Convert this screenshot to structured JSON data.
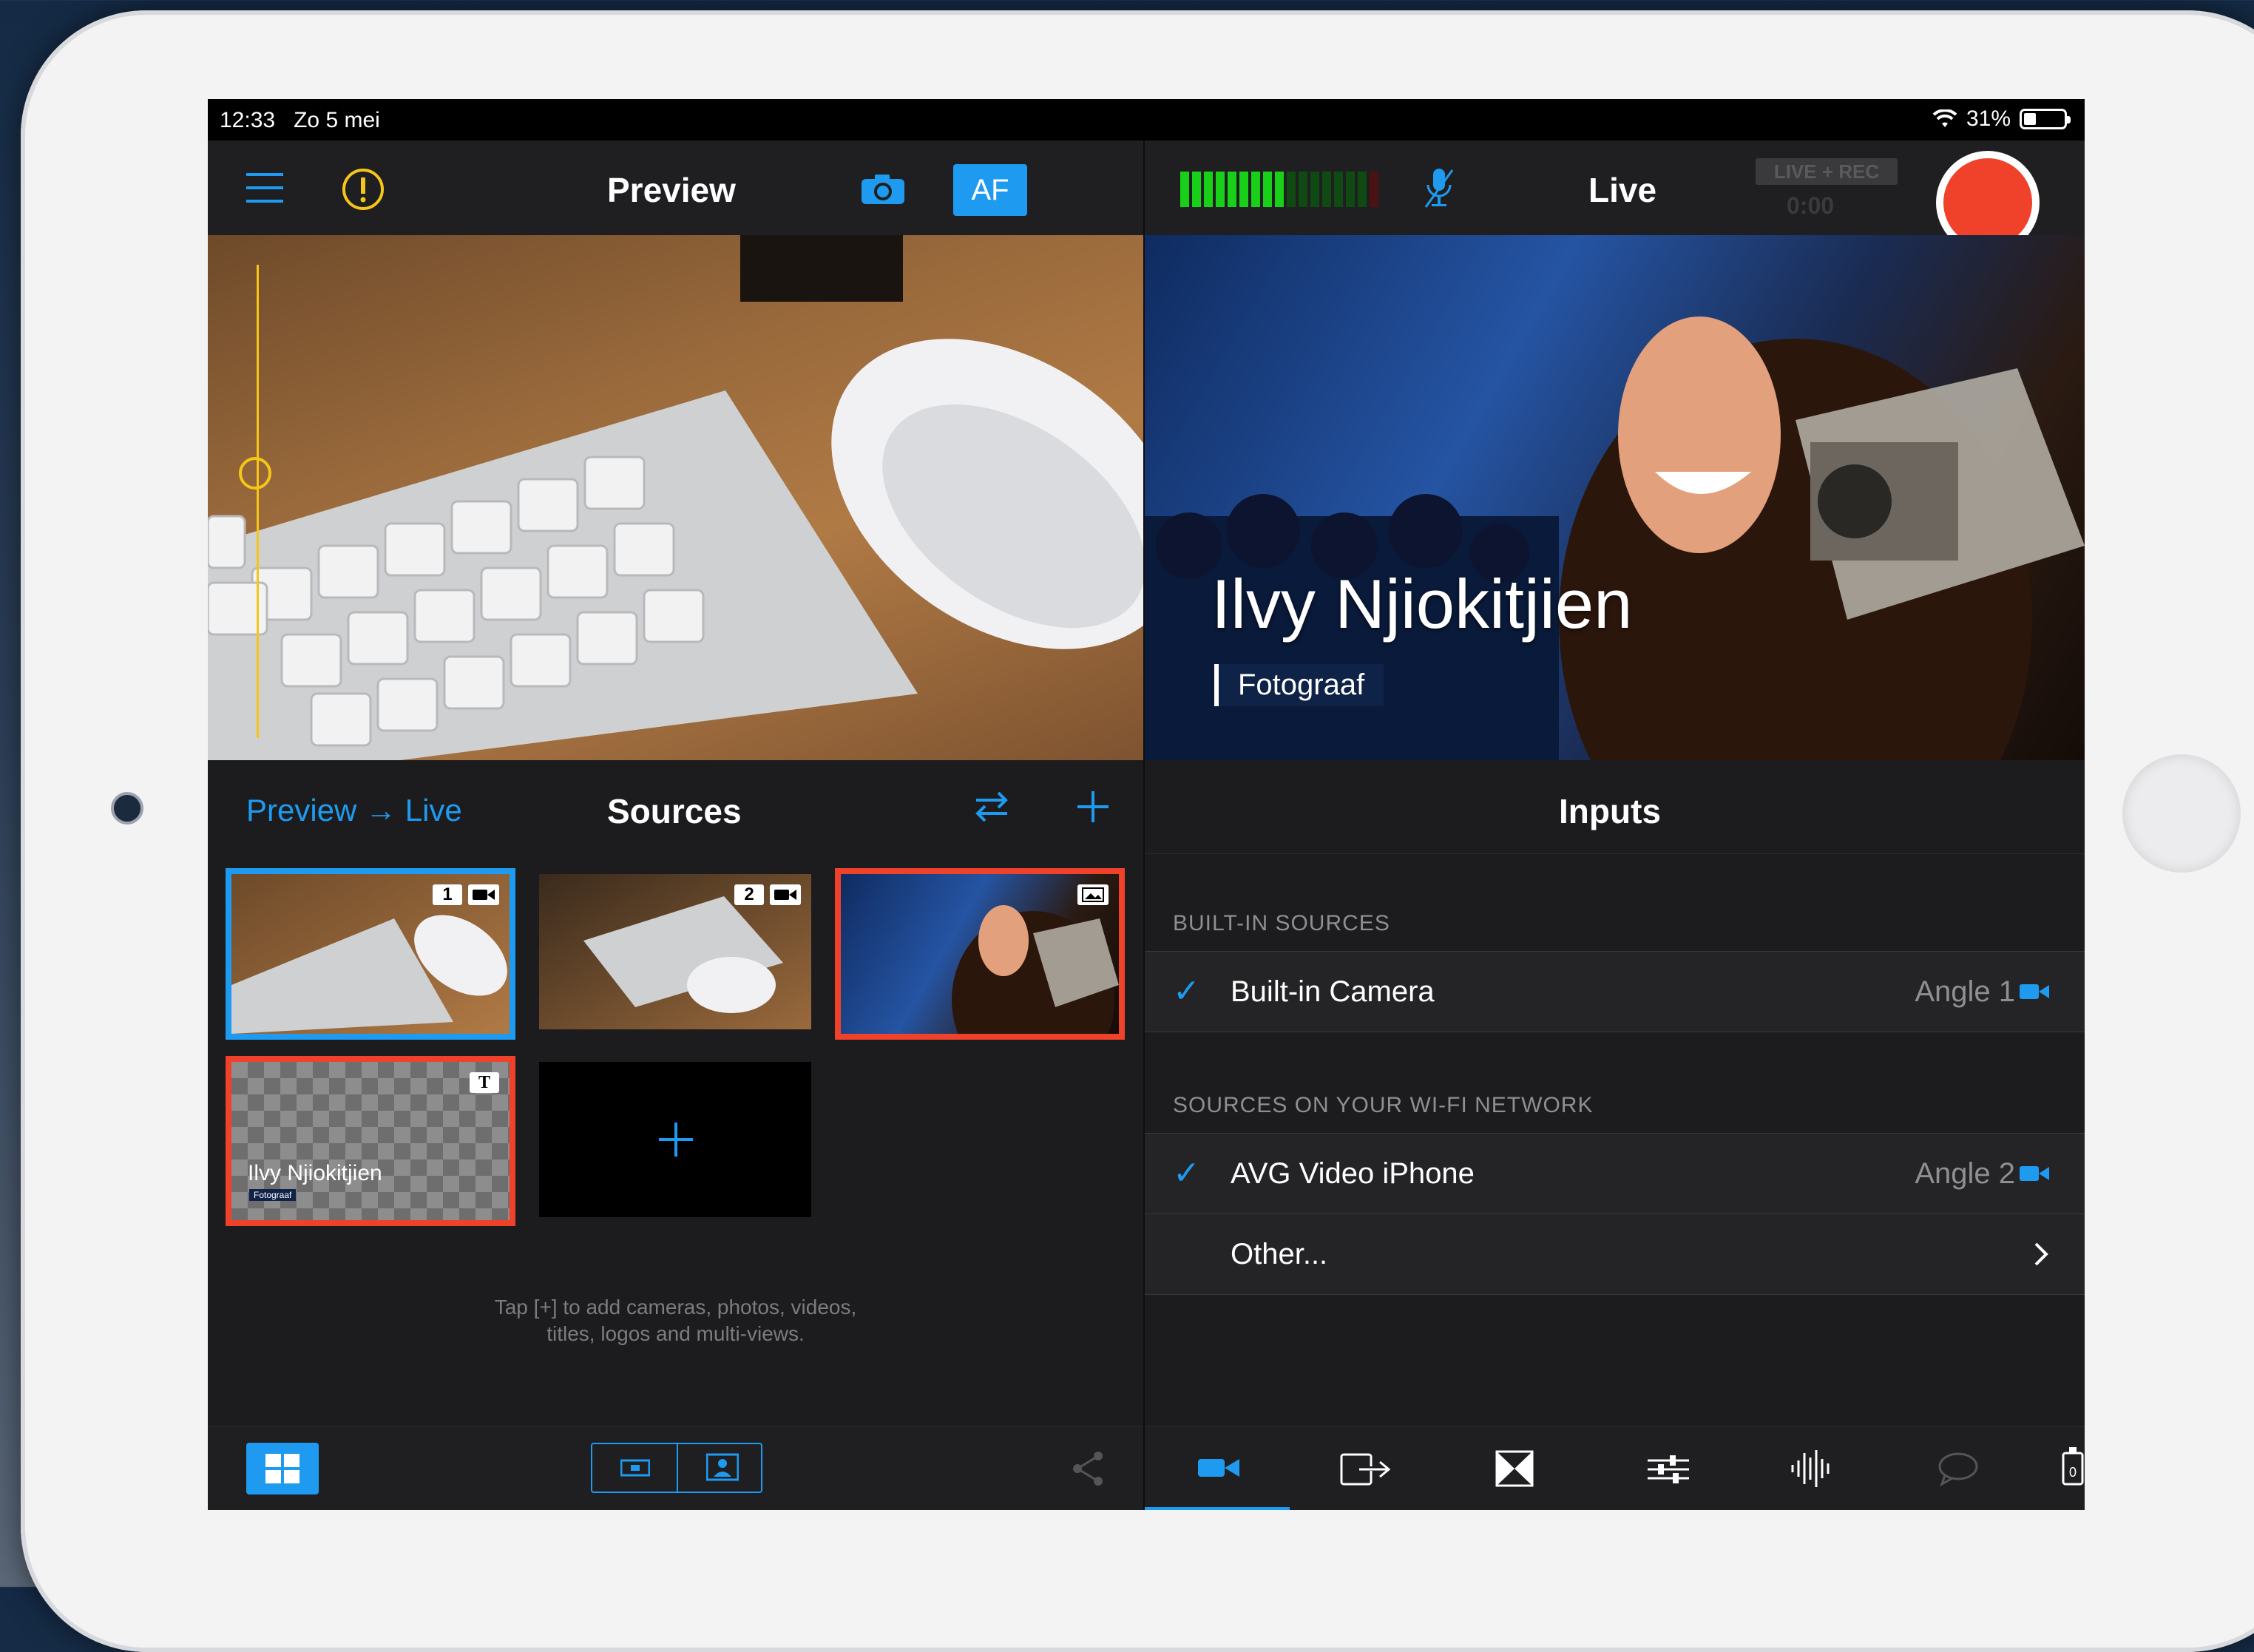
{
  "status": {
    "time": "12:33",
    "date": "Zo 5 mei",
    "battery": "31%",
    "battery_level": 0.31
  },
  "preview": {
    "title": "Preview",
    "af_label": "AF"
  },
  "live": {
    "title": "Live",
    "badge": "LIVE + REC",
    "timer": "0:00",
    "lower_third_name": "Ilvy Njiokitjien",
    "lower_third_role": "Fotograaf"
  },
  "sources": {
    "title": "Sources",
    "preview_live_label": "Preview",
    "live_label": "Live",
    "tiles": [
      {
        "number": "1",
        "type": "camera",
        "state": "preview"
      },
      {
        "number": "2",
        "type": "camera",
        "state": "idle"
      },
      {
        "type": "image",
        "state": "live"
      },
      {
        "type": "title",
        "badge": "T",
        "name": "Ilvy Njiokitjien",
        "role": "Fotograaf",
        "state": "live"
      }
    ],
    "hint_line1": "Tap [+] to add cameras, photos, videos,",
    "hint_line2": "titles, logos and multi-views."
  },
  "inputs": {
    "title": "Inputs",
    "built_in_header": "BUILT-IN SOURCES",
    "built_in": [
      {
        "name": "Built-in Camera",
        "angle": "Angle 1",
        "checked": true
      }
    ],
    "wifi_header": "SOURCES ON YOUR WI-FI NETWORK",
    "wifi": [
      {
        "name": "AVG Video iPhone",
        "angle": "Angle 2",
        "checked": true
      }
    ],
    "other_label": "Other..."
  },
  "colors": {
    "accent": "#1e9bf0",
    "live_red": "#f0412b",
    "warning": "#f5c518",
    "meter_green": "#18d018"
  }
}
